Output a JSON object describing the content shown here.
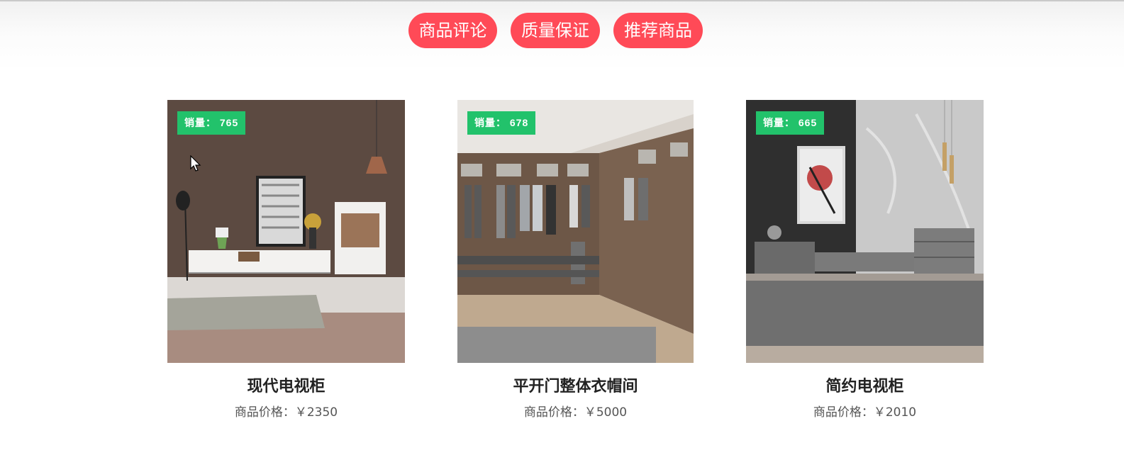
{
  "tabs": [
    "商品评论",
    "质量保证",
    "推荐商品"
  ],
  "products": [
    {
      "name": "现代电视柜",
      "sales_label": "销量： 765",
      "price_label": "商品价格：￥2350"
    },
    {
      "name": "平开门整体衣帽间",
      "sales_label": "销量： 678",
      "price_label": "商品价格：￥5000"
    },
    {
      "name": "简约电视柜",
      "sales_label": "销量： 665",
      "price_label": "商品价格：￥2010"
    }
  ],
  "colors": {
    "tab_bg": "#ff4a57",
    "badge_bg": "#22c26b"
  }
}
